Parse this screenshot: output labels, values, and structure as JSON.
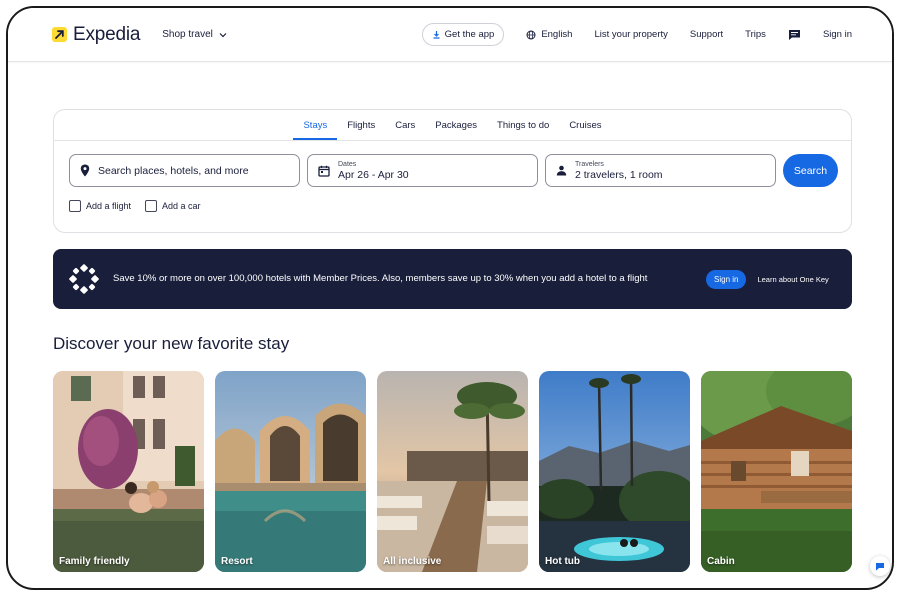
{
  "header": {
    "brand": "Expedia",
    "shop_travel": "Shop travel",
    "get_app": "Get the app",
    "language": "English",
    "list_property": "List your property",
    "support": "Support",
    "trips": "Trips",
    "sign_in": "Sign in"
  },
  "search": {
    "tabs": [
      {
        "label": "Stays",
        "active": true
      },
      {
        "label": "Flights",
        "active": false
      },
      {
        "label": "Cars",
        "active": false
      },
      {
        "label": "Packages",
        "active": false
      },
      {
        "label": "Things to do",
        "active": false
      },
      {
        "label": "Cruises",
        "active": false
      }
    ],
    "destination_placeholder": "Search places, hotels, and more",
    "dates_label": "Dates",
    "dates_value": "Apr 26 - Apr 30",
    "travelers_label": "Travelers",
    "travelers_value": "2 travelers, 1 room",
    "search_button": "Search",
    "add_flight": "Add a flight",
    "add_car": "Add a car"
  },
  "promo": {
    "text": "Save 10% or more on over 100,000 hotels with Member Prices. Also, members save up to 30% when you add a hotel to a flight",
    "sign_in": "Sign in",
    "learn": "Learn about One Key"
  },
  "discover": {
    "title": "Discover your new favorite stay",
    "cards": [
      {
        "label": "Family friendly"
      },
      {
        "label": "Resort"
      },
      {
        "label": "All inclusive"
      },
      {
        "label": "Hot tub"
      },
      {
        "label": "Cabin"
      }
    ]
  },
  "colors": {
    "accent": "#1668e3",
    "navy": "#191e3b",
    "logo_yellow": "#fddb32"
  }
}
